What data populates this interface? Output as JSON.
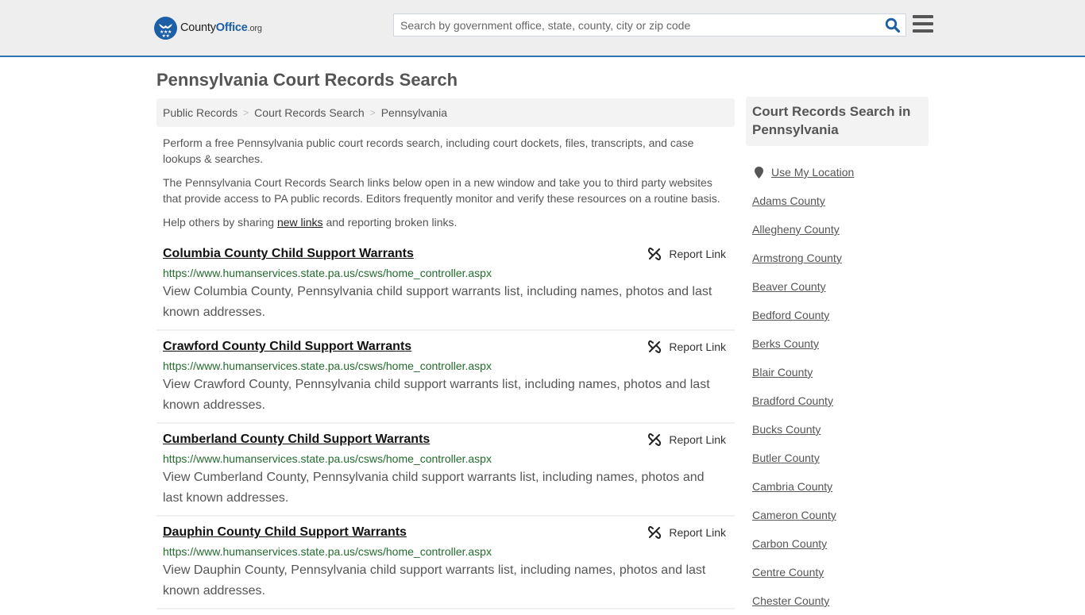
{
  "header": {
    "logo": {
      "name_main": "County",
      "name_accent": "Office",
      "tld": ".org"
    },
    "search": {
      "placeholder": "Search by government office, state, county, city or zip code",
      "value": ""
    },
    "colors": {
      "brand": "#1d5fa7",
      "header_bg": "#eeeeee",
      "header_border": "#2e75b0"
    }
  },
  "page": {
    "title": "Pennsylvania Court Records Search",
    "breadcrumb": [
      "Public Records",
      "Court Records Search",
      "Pennsylvania"
    ],
    "intro": {
      "p1": "Perform a free Pennsylvania public court records search, including court dockets, files, transcripts, and case lookups & searches.",
      "p2": "The Pennsylvania Court Records Search links below open in a new window and take you to third party websites that provide access to PA public records. Editors frequently monitor and verify these resources on a routine basis.",
      "p3_before": "Help others by sharing ",
      "p3_link": "new links",
      "p3_after": " and reporting broken links."
    }
  },
  "results": [
    {
      "title": "Columbia County Child Support Warrants",
      "url": "https://www.humanservices.state.pa.us/csws/home_controller.aspx",
      "description": "View Columbia County, Pennsylvania child support warrants list, including names, photos and last known addresses.",
      "report_label": "Report Link"
    },
    {
      "title": "Crawford County Child Support Warrants",
      "url": "https://www.humanservices.state.pa.us/csws/home_controller.aspx",
      "description": "View Crawford County, Pennsylvania child support warrants list, including names, photos and last known addresses.",
      "report_label": "Report Link"
    },
    {
      "title": "Cumberland County Child Support Warrants",
      "url": "https://www.humanservices.state.pa.us/csws/home_controller.aspx",
      "description": "View Cumberland County, Pennsylvania child support warrants list, including names, photos and last known addresses.",
      "report_label": "Report Link"
    },
    {
      "title": "Dauphin County Child Support Warrants",
      "url": "https://www.humanservices.state.pa.us/csws/home_controller.aspx",
      "description": "View Dauphin County, Pennsylvania child support warrants list, including names, photos and last known addresses.",
      "report_label": "Report Link"
    }
  ],
  "sidebar": {
    "heading": "Court Records Search in Pennsylvania",
    "use_location": "Use My Location",
    "counties": [
      "Adams County",
      "Allegheny County",
      "Armstrong County",
      "Beaver County",
      "Bedford County",
      "Berks County",
      "Blair County",
      "Bradford County",
      "Bucks County",
      "Butler County",
      "Cambria County",
      "Cameron County",
      "Carbon County",
      "Centre County",
      "Chester County"
    ]
  }
}
